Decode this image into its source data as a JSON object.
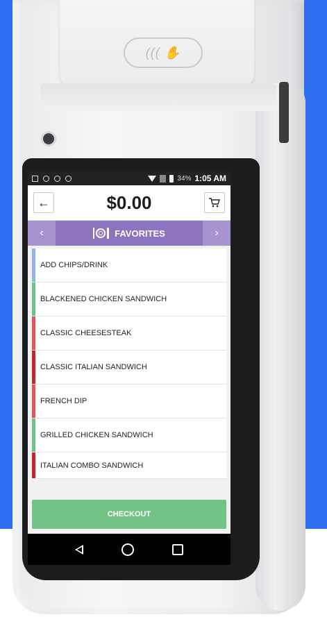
{
  "status_bar": {
    "icons": [
      "gallery-icon",
      "sync-icon",
      "sync-icon",
      "sync-icon"
    ],
    "battery_percent": "34%",
    "time": "1:05 AM"
  },
  "header": {
    "total": "$0.00",
    "back_icon": "←"
  },
  "category": {
    "title": "FAVORITES",
    "prev_label": "‹",
    "next_label": "›"
  },
  "items": [
    {
      "label": "ADD CHIPS/DRINK",
      "color": "#8fb7de"
    },
    {
      "label": "BLACKENED CHICKEN SANDWICH",
      "color": "#6fbf8f"
    },
    {
      "label": "CLASSIC CHEESESTEAK",
      "color": "#e0565b"
    },
    {
      "label": "CLASSIC ITALIAN SANDWICH",
      "color": "#c1272d"
    },
    {
      "label": "FRENCH DIP",
      "color": "#e0565b"
    },
    {
      "label": "GRILLED CHICKEN SANDWICH",
      "color": "#6fbf8f"
    },
    {
      "label": "ITALIAN COMBO SANDWICH",
      "color": "#c1272d"
    }
  ],
  "checkout": {
    "label": "CHECKOUT",
    "color": "#73c386"
  },
  "colors": {
    "background": "#2f6df0",
    "accent": "#8d74c0"
  }
}
